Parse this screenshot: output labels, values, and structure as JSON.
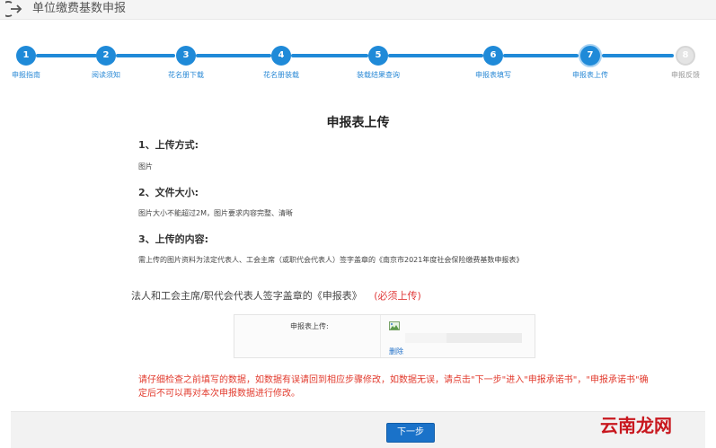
{
  "header": {
    "title": "单位缴费基数申报"
  },
  "stepper": {
    "steps": [
      {
        "num": "1",
        "label": "申报指南",
        "state": "done"
      },
      {
        "num": "2",
        "label": "阅读须知",
        "state": "done"
      },
      {
        "num": "3",
        "label": "花名册下载",
        "state": "done"
      },
      {
        "num": "4",
        "label": "花名册装载",
        "state": "done"
      },
      {
        "num": "5",
        "label": "装载结果查询",
        "state": "done"
      },
      {
        "num": "6",
        "label": "申报表填写",
        "state": "done"
      },
      {
        "num": "7",
        "label": "申报表上传",
        "state": "current"
      },
      {
        "num": "8",
        "label": "申报反馈",
        "state": "pending"
      }
    ]
  },
  "main": {
    "title": "申报表上传",
    "sections": [
      {
        "heading": "1、上传方式:",
        "text": "图片"
      },
      {
        "heading": "2、文件大小:",
        "text": "图片大小不能超过2M，图片要求内容完整、清晰"
      },
      {
        "heading": "3、上传的内容:",
        "text": "需上传的图片资料为法定代表人、工会主席（或职代会代表人）签字盖章的《南京市2021年度社会保险缴费基数申报表》"
      }
    ],
    "requirement": {
      "text": "法人和工会主席/职代会代表人签字盖章的《申报表》",
      "required": "(必须上传)"
    },
    "upload": {
      "label": "申报表上传:",
      "delete_label": "删除"
    },
    "warning": "请仔细检查之前填写的数据，如数据有误请回到相应步骤修改，如数据无误，请点击\"下一步\"进入\"申报承诺书\"，\"申报承诺书\"确定后不可以再对本次申报数据进行修改。"
  },
  "footer": {
    "next_label": "下一步"
  },
  "watermark": {
    "text": "云南龙网"
  },
  "colors": {
    "accent": "#1f8ad8",
    "warning": "#e23b2e",
    "button": "#1a72c9"
  }
}
